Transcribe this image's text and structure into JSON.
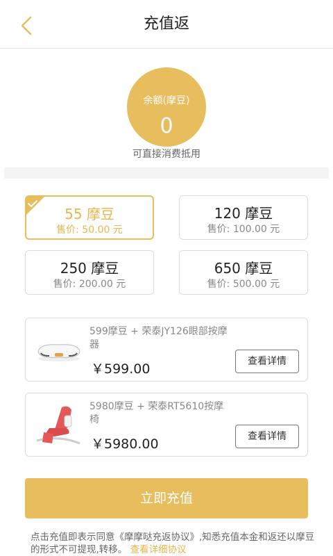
{
  "header": {
    "title": "充值返"
  },
  "balance": {
    "label": "余额(摩豆)",
    "value": "0",
    "note": "可直接消费抵用"
  },
  "options": [
    {
      "amount": "55 摩豆",
      "price": "售价: 50.00 元",
      "selected": true
    },
    {
      "amount": "120 摩豆",
      "price": "售价: 100.00 元",
      "selected": false
    },
    {
      "amount": "250 摩豆",
      "price": "售价: 200.00 元",
      "selected": false
    },
    {
      "amount": "650 摩豆",
      "price": "售价: 500.00 元",
      "selected": false
    }
  ],
  "products": [
    {
      "name": "599摩豆 + 荣泰JY126眼部按摩器",
      "price": "￥599.00",
      "button": "查看详情",
      "image": "eye-massager-image"
    },
    {
      "name": "5980摩豆 + 荣泰RT5610按摩椅",
      "price": "￥5980.00",
      "button": "查看详情",
      "image": "massage-chair-image"
    }
  ],
  "recharge_button": "立即充值",
  "agreement": {
    "text": "点击充值即表示同意《摩摩哒充返协议》,知悉充值本金和返还以摩豆的形式不可提现,转移。",
    "link": "查看详细协议"
  },
  "colors": {
    "accent": "#e8bd5d",
    "border": "#dcdcdc",
    "text_muted": "#888888"
  }
}
